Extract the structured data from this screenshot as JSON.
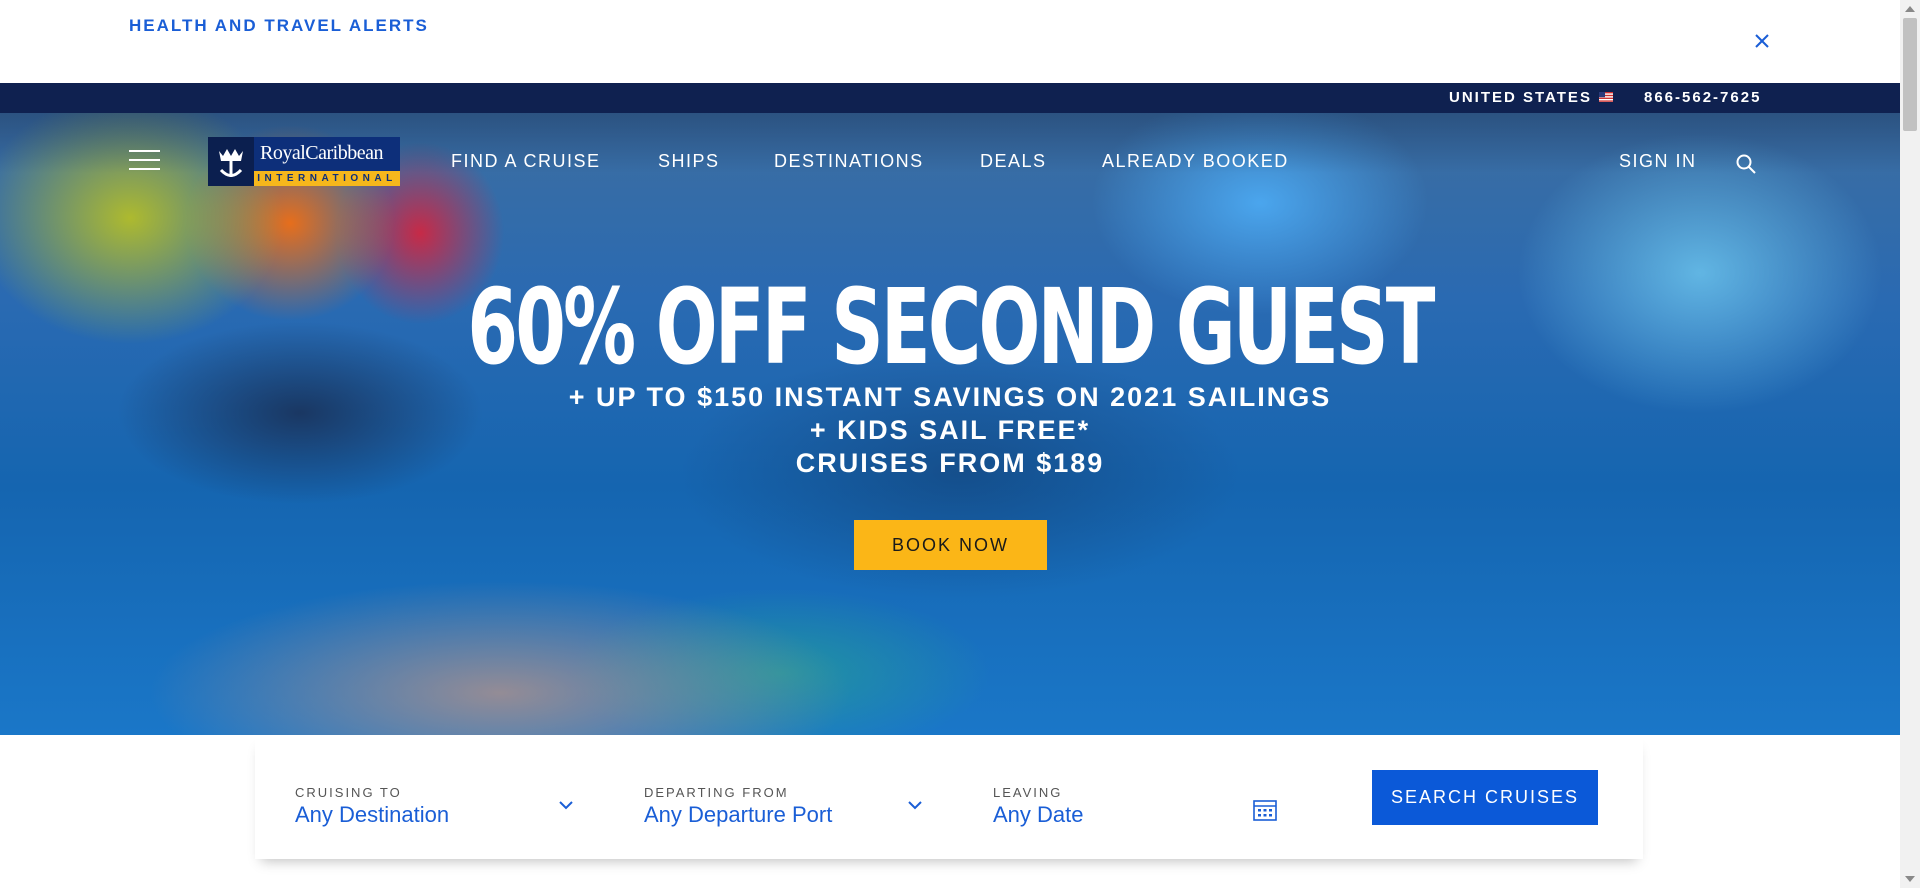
{
  "alert_bar": {
    "link": "HEALTH AND TRAVEL ALERTS",
    "close_icon": "close-icon"
  },
  "utility_bar": {
    "country": "UNITED STATES",
    "flag_icon": "us-flag-icon",
    "phone": "866-562-7625"
  },
  "header": {
    "logo": {
      "name": "RoyalCaribbean",
      "tagline": "INTERNATIONAL"
    },
    "nav": [
      {
        "label": "FIND A CRUISE"
      },
      {
        "label": "SHIPS"
      },
      {
        "label": "DESTINATIONS"
      },
      {
        "label": "DEALS"
      },
      {
        "label": "ALREADY BOOKED"
      }
    ],
    "sign_in": "SIGN IN",
    "search_icon": "search-icon"
  },
  "hero": {
    "headline": "60% OFF SECOND GUEST",
    "lines": [
      "+ UP TO $150 INSTANT SAVINGS ON 2021 SAILINGS",
      "+ KIDS SAIL FREE*",
      "CRUISES FROM $189"
    ],
    "cta": "BOOK NOW"
  },
  "search": {
    "cruising_to": {
      "label": "CRUISING TO",
      "value": "Any Destination"
    },
    "departing_from": {
      "label": "DEPARTING FROM",
      "value": "Any Departure Port"
    },
    "leaving": {
      "label": "LEAVING",
      "value": "Any Date"
    },
    "button": "SEARCH CRUISES"
  },
  "colors": {
    "brand_navy": "#0f2150",
    "accent_blue": "#1a5ed6",
    "cta_yellow": "#fbb617",
    "search_button": "#0b59d8"
  }
}
